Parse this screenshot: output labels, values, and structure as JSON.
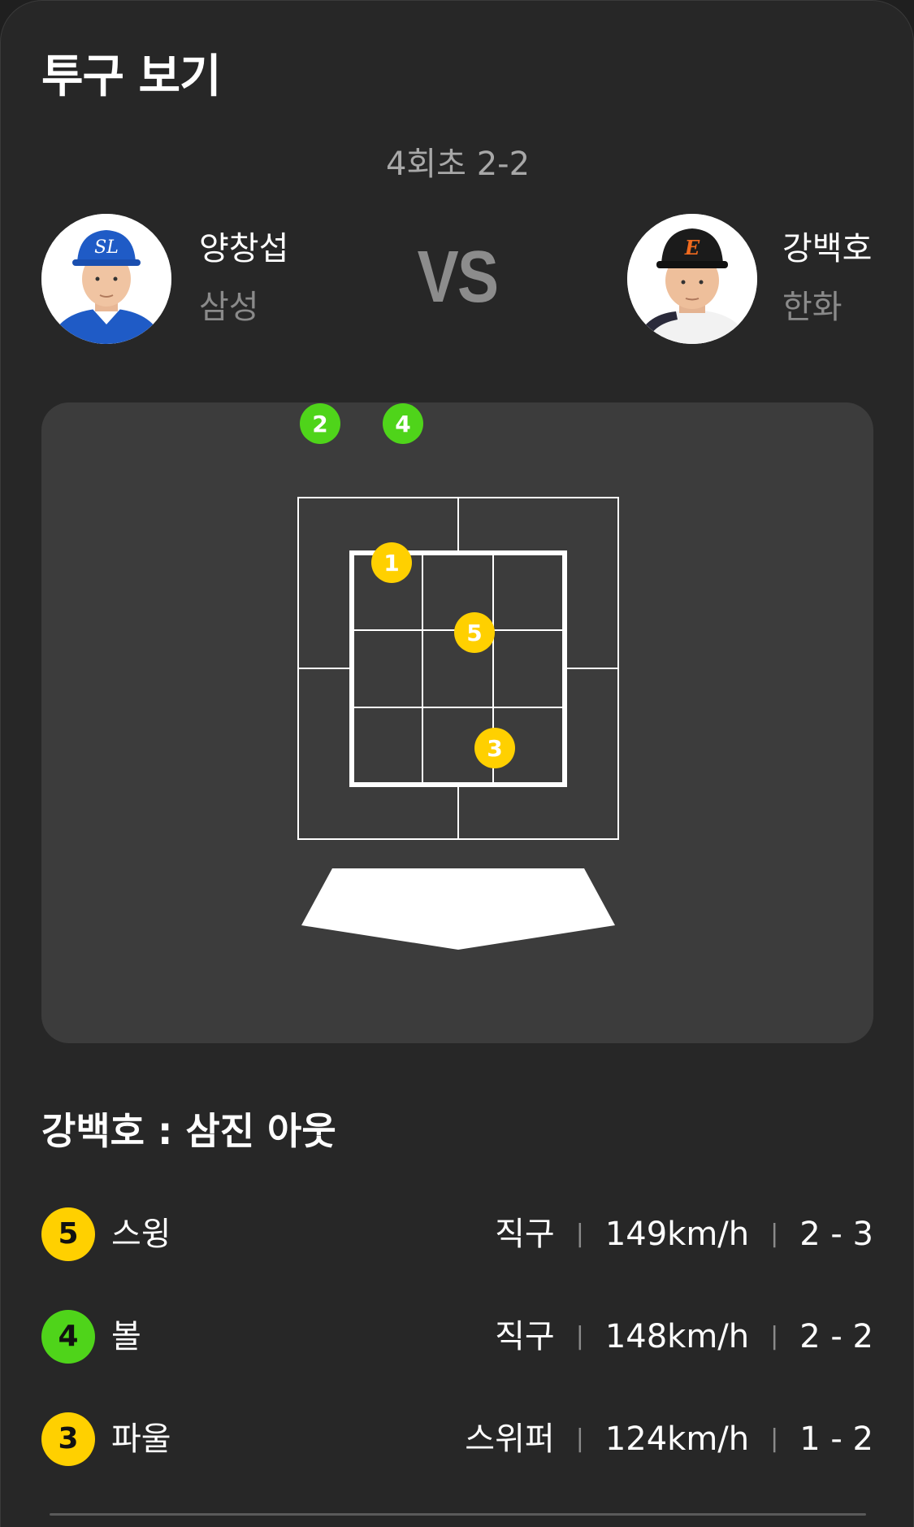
{
  "title": "투구 보기",
  "inning": "4회초 2-2",
  "vs_text": "VS",
  "pitcher": {
    "name": "양창섭",
    "team": "삼성"
  },
  "batter": {
    "name": "강백호",
    "team": "한화"
  },
  "colors": {
    "strike": "#ffd000",
    "ball": "#4fd41a",
    "panel": "#3c3c3c",
    "background": "#272727"
  },
  "zone_pitches": [
    {
      "num": "1",
      "type": "strike"
    },
    {
      "num": "2",
      "type": "ball"
    },
    {
      "num": "3",
      "type": "strike"
    },
    {
      "num": "4",
      "type": "ball"
    },
    {
      "num": "5",
      "type": "strike"
    }
  ],
  "result": "강백호 : 삼진 아웃",
  "pitches": [
    {
      "num": "5",
      "type": "strike",
      "label": "스윙",
      "pitch": "직구",
      "speed": "149km/h",
      "count": "2 - 3"
    },
    {
      "num": "4",
      "type": "ball",
      "label": "볼",
      "pitch": "직구",
      "speed": "148km/h",
      "count": "2 - 2"
    },
    {
      "num": "3",
      "type": "strike",
      "label": "파울",
      "pitch": "스위퍼",
      "speed": "124km/h",
      "count": "1 - 2"
    }
  ]
}
